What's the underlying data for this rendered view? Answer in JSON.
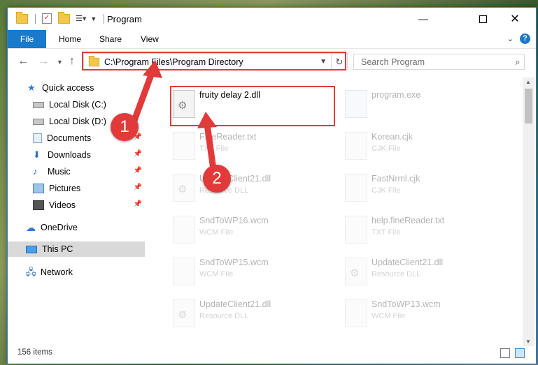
{
  "window": {
    "title": "Program"
  },
  "ribbon": {
    "file": "File",
    "tabs": [
      "Home",
      "Share",
      "View"
    ]
  },
  "address": {
    "path": "C:\\Program Files\\Program Directory"
  },
  "search": {
    "placeholder": "Search Program"
  },
  "sidebar": {
    "items": [
      {
        "label": "Quick access",
        "icon": "star-icon"
      },
      {
        "label": "Local Disk (C:)",
        "icon": "disk-icon"
      },
      {
        "label": "Local Disk (D:)",
        "icon": "disk-icon"
      },
      {
        "label": "Documents",
        "icon": "documents-icon",
        "pinned": true
      },
      {
        "label": "Downloads",
        "icon": "download-icon",
        "pinned": true
      },
      {
        "label": "Music",
        "icon": "music-icon",
        "pinned": true
      },
      {
        "label": "Pictures",
        "icon": "pictures-icon",
        "pinned": true
      },
      {
        "label": "Videos",
        "icon": "videos-icon",
        "pinned": true
      },
      {
        "label": "OneDrive",
        "icon": "cloud-icon"
      },
      {
        "label": "This PC",
        "icon": "pc-icon",
        "selected": true
      },
      {
        "label": "Network",
        "icon": "network-icon"
      }
    ]
  },
  "files": [
    {
      "name": "fruity delay 2.dll",
      "type": "",
      "icon": "dll-gear-icon"
    },
    {
      "name": "program.exe",
      "type": "",
      "icon": "exe-icon"
    },
    {
      "name": "FineReader.txt",
      "type": "TXT File",
      "icon": "txt-icon"
    },
    {
      "name": "Korean.cjk",
      "type": "CJK File",
      "icon": "file-icon"
    },
    {
      "name": "UpdateClient21.dll",
      "type": "Resource DLL",
      "icon": "dll-gear-icon"
    },
    {
      "name": "FastNrml.cjk",
      "type": "CJK File",
      "icon": "file-icon"
    },
    {
      "name": "SndToWP16.wcm",
      "type": "WCM File",
      "icon": "file-icon"
    },
    {
      "name": "help.fineReader.txt",
      "type": "TXT File",
      "icon": "txt-icon"
    },
    {
      "name": "SndToWP15.wcm",
      "type": "WCM File",
      "icon": "file-icon"
    },
    {
      "name": "UpdateClient21.dll",
      "type": "Resource DLL",
      "icon": "dll-gear-icon"
    },
    {
      "name": "UpdateClient21.dll",
      "type": "Resource DLL",
      "icon": "dll-gear-icon"
    },
    {
      "name": "SndToWP13.wcm",
      "type": "WCM File",
      "icon": "file-icon"
    }
  ],
  "status": {
    "count": "156 items"
  },
  "callouts": [
    "1",
    "2"
  ],
  "colors": {
    "accent": "#1979ca",
    "highlight": "#e23a3a",
    "selected_bg": "#d9d9d9"
  }
}
